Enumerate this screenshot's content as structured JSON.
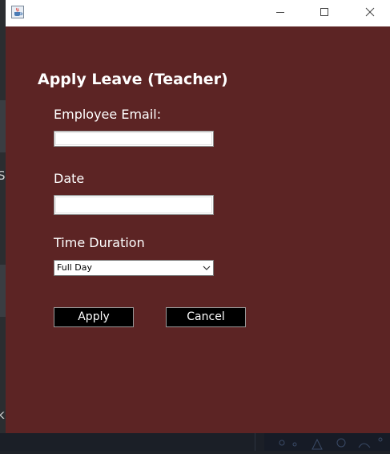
{
  "window": {
    "controls": {
      "minimize_icon": "minimize-icon",
      "maximize_icon": "maximize-icon",
      "close_icon": "close-icon"
    },
    "app_icon": "java-cup-icon"
  },
  "form": {
    "heading": "Apply Leave (Teacher)",
    "email_label": "Employee Email:",
    "email_value": "",
    "date_label": "Date",
    "date_value": "",
    "time_label": "Time Duration",
    "time_selected": "Full Day",
    "apply_label": "Apply",
    "cancel_label": "Cancel"
  },
  "background": {
    "glyph_s": "S",
    "glyph_k": "k"
  },
  "colors": {
    "panel_bg": "#5c2424",
    "button_bg": "#000000",
    "text": "#ffffff"
  }
}
